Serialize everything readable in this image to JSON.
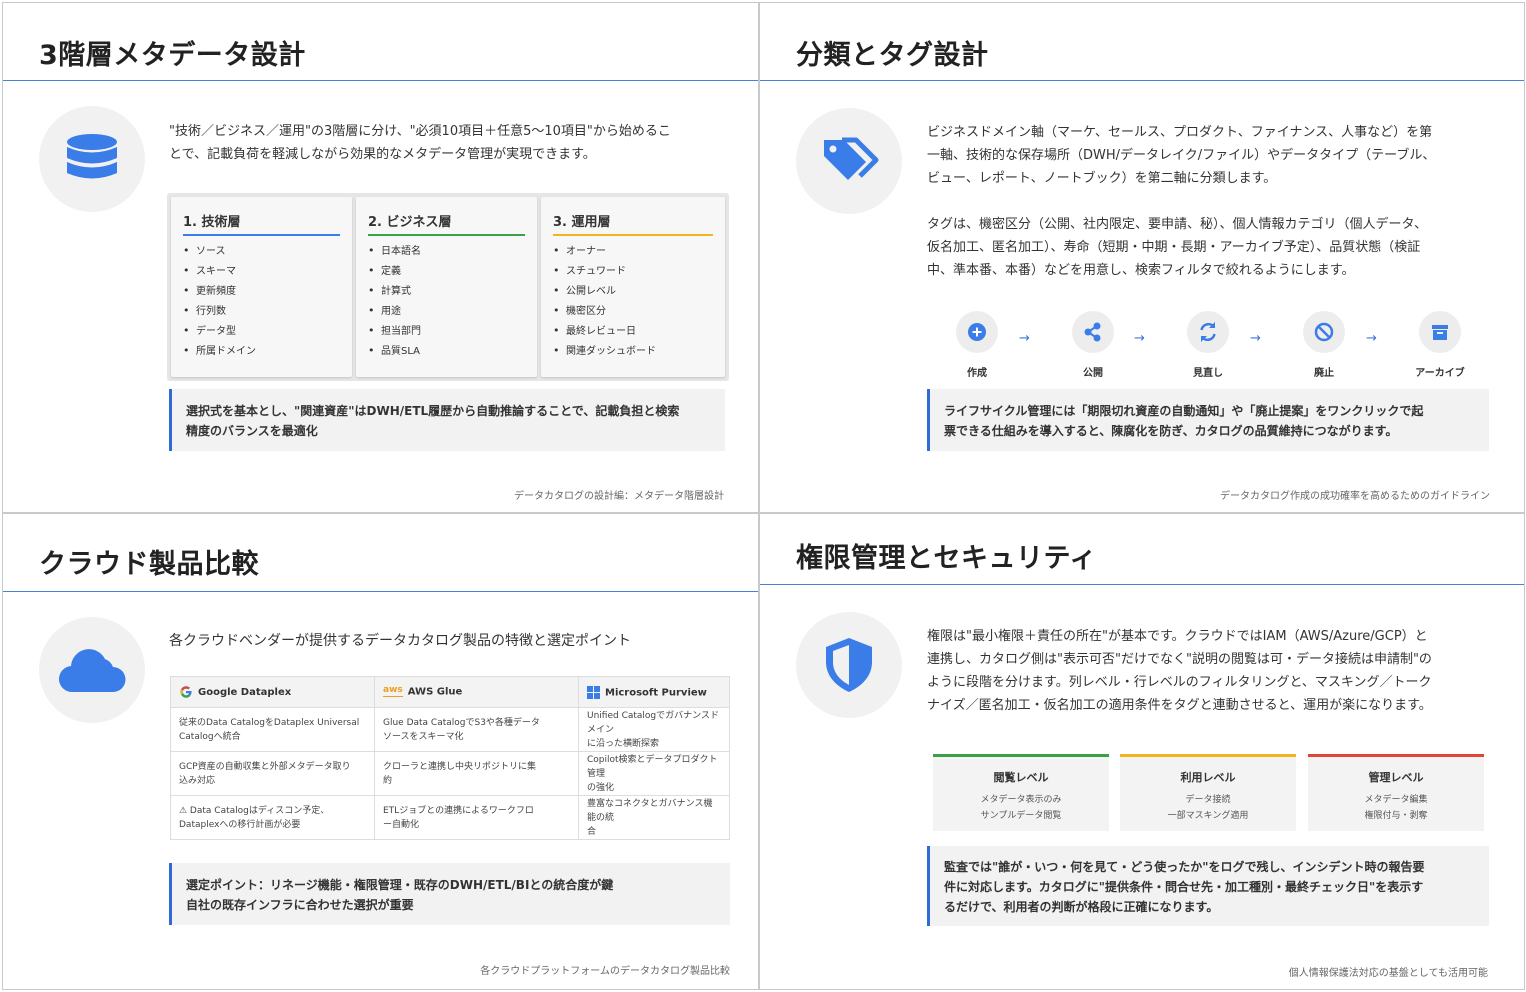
{
  "panel1": {
    "title": "3階層メタデータ設計",
    "intro_line1": "\"技術／ビジネス／運用\"の3階層に分け、\"必須10項目＋任意5〜10項目\"から始めるこ",
    "intro_line2": "とで、記載負荷を軽減しながら効果的なメタデータ管理が実現できます。",
    "layers": [
      {
        "title": "1. 技術層",
        "items": [
          "ソース",
          "スキーマ",
          "更新頻度",
          "行列数",
          "データ型",
          "所属ドメイン"
        ]
      },
      {
        "title": "2. ビジネス層",
        "items": [
          "日本語名",
          "定義",
          "計算式",
          "用途",
          "担当部門",
          "品質SLA"
        ]
      },
      {
        "title": "3. 運用層",
        "items": [
          "オーナー",
          "スチュワード",
          "公開レベル",
          "機密区分",
          "最終レビュー日",
          "関連ダッシュボード"
        ]
      }
    ],
    "note_line1": "選択式を基本とし、\"関連資産\"はDWH/ETL履歴から自動推論することで、記載負担と検索",
    "note_line2": "精度のバランスを最適化",
    "footer": "データカタログの設計編：メタデータ階層設計"
  },
  "panel2": {
    "title": "分類とタグ設計",
    "para1_line1": "ビジネスドメイン軸（マーケ、セールス、プロダクト、ファイナンス、人事など）を第",
    "para1_line2": "一軸、技術的な保存場所（DWH/データレイク/ファイル）やデータタイプ（テーブル、",
    "para1_line3": "ビュー、レポート、ノートブック）を第二軸に分類します。",
    "para2_line1": "タグは、機密区分（公開、社内限定、要申請、秘）、個人情報カテゴリ（個人データ、",
    "para2_line2": "仮名加工、匿名加工）、寿命（短期・中期・長期・アーカイブ予定）、品質状態（検証",
    "para2_line3": "中、準本番、本番）などを用意し、検索フィルタで絞れるようにします。",
    "lifecycle": [
      "作成",
      "公開",
      "見直し",
      "廃止",
      "アーカイブ"
    ],
    "arrow": "→",
    "note_line1": "ライフサイクル管理には「期限切れ資産の自動通知」や「廃止提案」をワンクリックで起",
    "note_line2": "票できる仕組みを導入すると、陳腐化を防ぎ、カタログの品質維持につながります。",
    "footer": "データカタログ作成の成功確率を高めるためのガイドライン"
  },
  "panel3": {
    "title": "クラウド製品比較",
    "intro": "各クラウドベンダーが提供するデータカタログ製品の特徴と選定ポイント",
    "headers": [
      "Google Dataplex",
      "AWS Glue",
      "Microsoft Purview"
    ],
    "aws_logo_text": "aws",
    "rows": [
      [
        [
          "従来のData CatalogをDataplex Universal",
          "Catalogへ統合"
        ],
        [
          "Glue Data CatalogでS3や各種データ",
          "ソースをスキーマ化"
        ],
        [
          "Unified Catalogでガバナンスドメイン",
          "に沿った横断探索"
        ]
      ],
      [
        [
          "GCP資産の自動収集と外部メタデータ取り",
          "込み対応"
        ],
        [
          "クローラと連携し中央リポジトリに集",
          "約"
        ],
        [
          "Copilot検索とデータプロダクト管理",
          "の強化"
        ]
      ],
      [
        [
          "⚠ Data Catalogはディスコン予定、",
          "Dataplexへの移行計画が必要"
        ],
        [
          "ETLジョブとの連携によるワークフロ",
          "ー自動化"
        ],
        [
          "豊富なコネクタとガバナンス機能の統",
          "合"
        ]
      ]
    ],
    "note_line1": "選定ポイント：リネージ機能・権限管理・既存のDWH/ETL/BIとの統合度が鍵",
    "note_line2": "自社の既存インフラに合わせた選択が重要",
    "footer": "各クラウドプラットフォームのデータカタログ製品比較"
  },
  "panel4": {
    "title": "権限管理とセキュリティ",
    "para_line1": "権限は\"最小権限＋責任の所在\"が基本です。クラウドではIAM（AWS/Azure/GCP）と",
    "para_line2": "連携し、カタログ側は\"表示可否\"だけでなく\"説明の閲覧は可・データ接続は申請制\"の",
    "para_line3": "ように段階を分けます。列レベル・行レベルのフィルタリングと、マスキング／トーク",
    "para_line4": "ナイズ／匿名加工・仮名加工の適用条件をタグと連動させると、運用が楽になります。",
    "levels": [
      {
        "title": "閲覧レベル",
        "line1": "メタデータ表示のみ",
        "line2": "サンプルデータ閲覧",
        "color": "#3aa14a"
      },
      {
        "title": "利用レベル",
        "line1": "データ接続",
        "line2": "一部マスキング適用",
        "color": "#f2b51f"
      },
      {
        "title": "管理レベル",
        "line1": "メタデータ編集",
        "line2": "権限付与・剥奪",
        "color": "#e0453a"
      }
    ],
    "note_line1": "監査では\"誰が・いつ・何を見て・どう使ったか\"をログで残し、インシデント時の報告要",
    "note_line2": "件に対応します。カタログに\"提供条件・問合せ先・加工種別・最終チェック日\"を表示す",
    "note_line3": "るだけで、利用者の判断が格段に正確になります。",
    "footer": "個人情報保護法対応の基盤としても活用可能"
  },
  "colors": {
    "accent": "#2f6bd6",
    "icon_blue": "#3a7de8",
    "layer1": "#3a7de8",
    "layer2": "#3aa14a",
    "layer3": "#f2b51f"
  }
}
